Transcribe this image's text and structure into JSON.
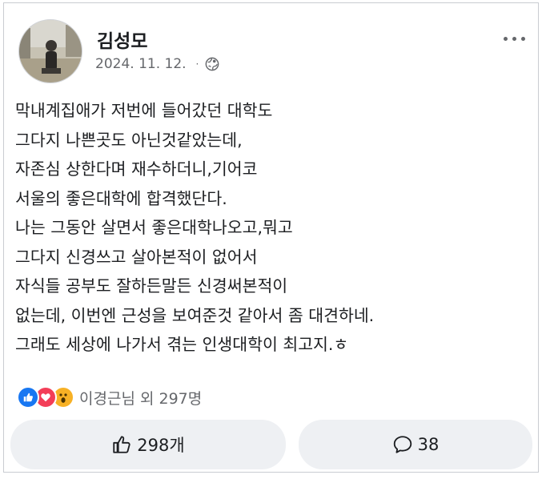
{
  "post": {
    "author": "김성모",
    "date": "2024. 11. 12.",
    "separator": "·",
    "privacy_icon": "globe-icon",
    "more_icon": "more-options-icon",
    "lines": [
      "막내계집애가 저번에 들어갔던 대학도",
      "그다지 나쁜곳도 아닌것같았는데,",
      "자존심 상한다며 재수하더니,기어코",
      "서울의 좋은대학에 합격했단다.",
      "나는 그동안 살면서 좋은대학나오고,뭐고",
      "그다지 신경쓰고 살아본적이 없어서",
      "자식들 공부도 잘하든말든 신경써본적이",
      "없는데, 이번엔 근성을 보여준것 같아서 좀 대견하네.",
      "그래도 세상에 나가서 겪는 인생대학이 최고지.ㅎ"
    ]
  },
  "reactions": {
    "icons": [
      "like-reaction-icon",
      "love-reaction-icon",
      "wow-reaction-icon"
    ],
    "summary": "이경근님 외 297명"
  },
  "actions": {
    "like_count": "298개",
    "comment_count": "38"
  },
  "colors": {
    "text": "#1c1e21",
    "secondary": "#65676b",
    "button_bg": "#eef0f3",
    "like_blue": "#1877f2",
    "love_red": "#f33e58",
    "wow_yellow": "#f7b125"
  }
}
